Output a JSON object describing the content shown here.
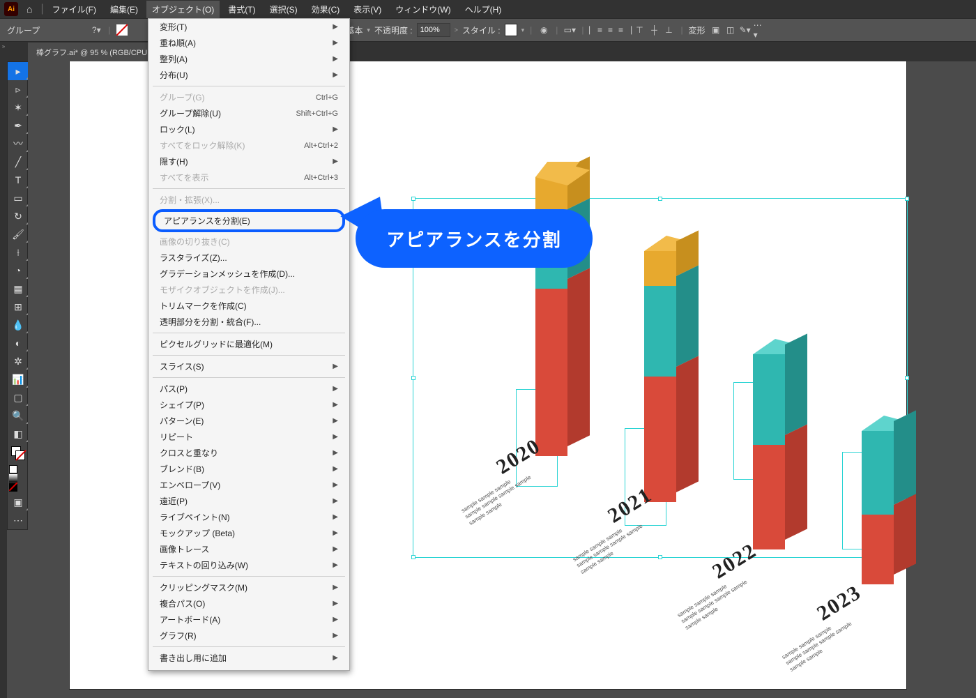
{
  "menubar": {
    "items": [
      "ファイル(F)",
      "編集(E)",
      "オブジェクト(O)",
      "書式(T)",
      "選択(S)",
      "効果(C)",
      "表示(V)",
      "ウィンドウ(W)",
      "ヘルプ(H)"
    ],
    "active_index": 2
  },
  "controlbar": {
    "selection_label": "グループ",
    "basic_label": "基本",
    "opacity_label": "不透明度 :",
    "opacity_value": "100%",
    "style_label": "スタイル :",
    "transform_label": "変形"
  },
  "tab": {
    "title": "棒グラフ.ai* @ 95 % (RGB/CPU プレビュー)"
  },
  "dropdown": {
    "items": [
      {
        "label": "変形(T)",
        "sub": true
      },
      {
        "label": "重ね順(A)",
        "sub": true
      },
      {
        "label": "整列(A)",
        "sub": true
      },
      {
        "label": "分布(U)",
        "sub": true
      },
      {
        "sep": true
      },
      {
        "label": "グループ(G)",
        "short": "Ctrl+G",
        "disabled": true
      },
      {
        "label": "グループ解除(U)",
        "short": "Shift+Ctrl+G"
      },
      {
        "label": "ロック(L)",
        "sub": true
      },
      {
        "label": "すべてをロック解除(K)",
        "short": "Alt+Ctrl+2",
        "disabled": true
      },
      {
        "label": "隠す(H)",
        "sub": true
      },
      {
        "label": "すべてを表示",
        "short": "Alt+Ctrl+3",
        "disabled": true
      },
      {
        "sep": true
      },
      {
        "label": "分割・拡張(X)...",
        "disabled": true
      },
      {
        "label": "アピアランスを分割(E)",
        "highlight": true
      },
      {
        "label": "画像の切り抜き(C)",
        "disabled": true
      },
      {
        "label": "ラスタライズ(Z)..."
      },
      {
        "label": "グラデーションメッシュを作成(D)..."
      },
      {
        "label": "モザイクオブジェクトを作成(J)...",
        "disabled": true
      },
      {
        "label": "トリムマークを作成(C)"
      },
      {
        "label": "透明部分を分割・統合(F)..."
      },
      {
        "sep": true
      },
      {
        "label": "ピクセルグリッドに最適化(M)"
      },
      {
        "sep": true
      },
      {
        "label": "スライス(S)",
        "sub": true
      },
      {
        "sep": true
      },
      {
        "label": "パス(P)",
        "sub": true
      },
      {
        "label": "シェイプ(P)",
        "sub": true
      },
      {
        "label": "パターン(E)",
        "sub": true
      },
      {
        "label": "リピート",
        "sub": true
      },
      {
        "label": "クロスと重なり",
        "sub": true
      },
      {
        "label": "ブレンド(B)",
        "sub": true
      },
      {
        "label": "エンベロープ(V)",
        "sub": true
      },
      {
        "label": "遠近(P)",
        "sub": true
      },
      {
        "label": "ライブペイント(N)",
        "sub": true
      },
      {
        "label": "モックアップ (Beta)",
        "sub": true
      },
      {
        "label": "画像トレース",
        "sub": true
      },
      {
        "label": "テキストの回り込み(W)",
        "sub": true
      },
      {
        "sep": true
      },
      {
        "label": "クリッピングマスク(M)",
        "sub": true
      },
      {
        "label": "複合パス(O)",
        "sub": true
      },
      {
        "label": "アートボード(A)",
        "sub": true
      },
      {
        "label": "グラフ(R)",
        "sub": true
      },
      {
        "sep": true
      },
      {
        "label": "書き出し用に追加",
        "sub": true
      }
    ]
  },
  "callout": {
    "text": "アピアランスを分割"
  },
  "chart_data": {
    "type": "bar",
    "note": "Isometric 3D stacked columns (visual infographic) — exact values not labeled, approximate relative heights",
    "categories": [
      "2020",
      "2021",
      "2022",
      "2023"
    ],
    "series": [
      {
        "name": "red",
        "color": "#d94a3a",
        "values": [
          220,
          160,
          130,
          80
        ]
      },
      {
        "name": "teal",
        "color": "#2fb7b0",
        "values": [
          120,
          140,
          130,
          130
        ]
      },
      {
        "name": "orange",
        "color": "#e7a92e",
        "values": [
          80,
          60,
          0,
          0
        ]
      }
    ],
    "sub_text": "sample sample sample / sample sample sample sample / sample sample"
  },
  "labels": {
    "year0": "2020",
    "year1": "2021",
    "year2": "2022",
    "year3": "2023",
    "sub": "sample sample sample",
    "sub2": "sample sample sample sample",
    "sub3": "sample sample"
  },
  "app_logo": "Ai"
}
